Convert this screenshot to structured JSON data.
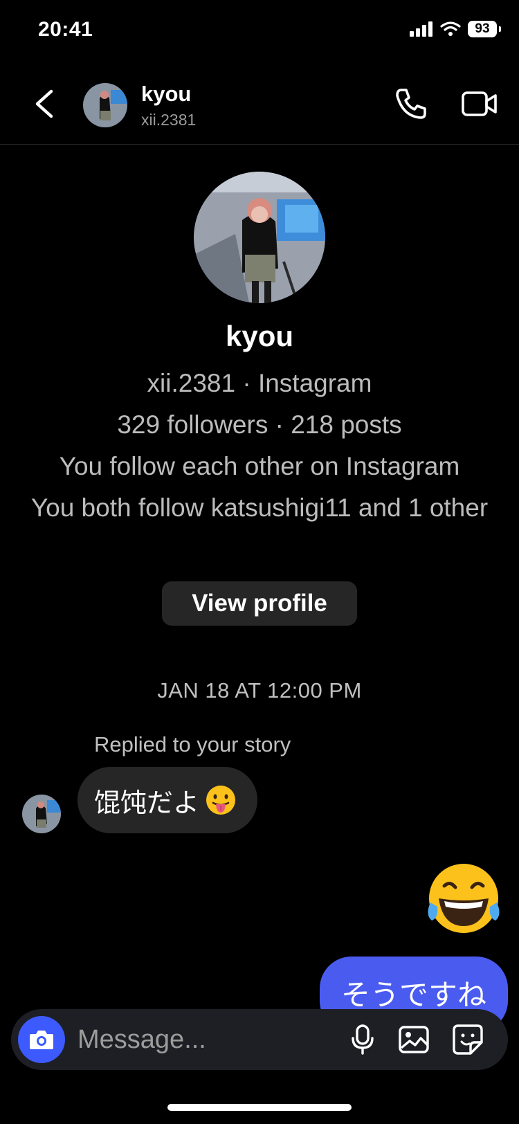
{
  "status_bar": {
    "time": "20:41",
    "battery": "93"
  },
  "header": {
    "name": "kyou",
    "username": "xii.2381",
    "icons": {
      "back": "chevron-left-icon",
      "call": "phone-icon",
      "video": "video-camera-icon"
    }
  },
  "profile": {
    "name": "kyou",
    "subtitle": "xii.2381 · Instagram",
    "stats": "329 followers · 218 posts",
    "mutual": "You follow each other on Instagram",
    "common_follow": "You both follow katsushigi11 and 1 other",
    "view_profile_label": "View profile"
  },
  "messages": {
    "date_separator": "JAN 18 AT 12:00 PM",
    "reply_label": "Replied to your story",
    "incoming_text": "馄饨だよ",
    "incoming_emoji": "tongue-out-emoji",
    "outgoing_emoji": "tears-of-joy-emoji",
    "outgoing_text": "そうですね"
  },
  "composer": {
    "placeholder": "Message...",
    "icons": {
      "camera": "camera-icon",
      "mic": "microphone-icon",
      "gallery": "gallery-icon",
      "sticker": "sticker-icon"
    }
  },
  "colors": {
    "background": "#000000",
    "incoming_bubble": "#262626",
    "outgoing_bubble": "#4a5cf0",
    "camera_button": "#3d5afe"
  }
}
